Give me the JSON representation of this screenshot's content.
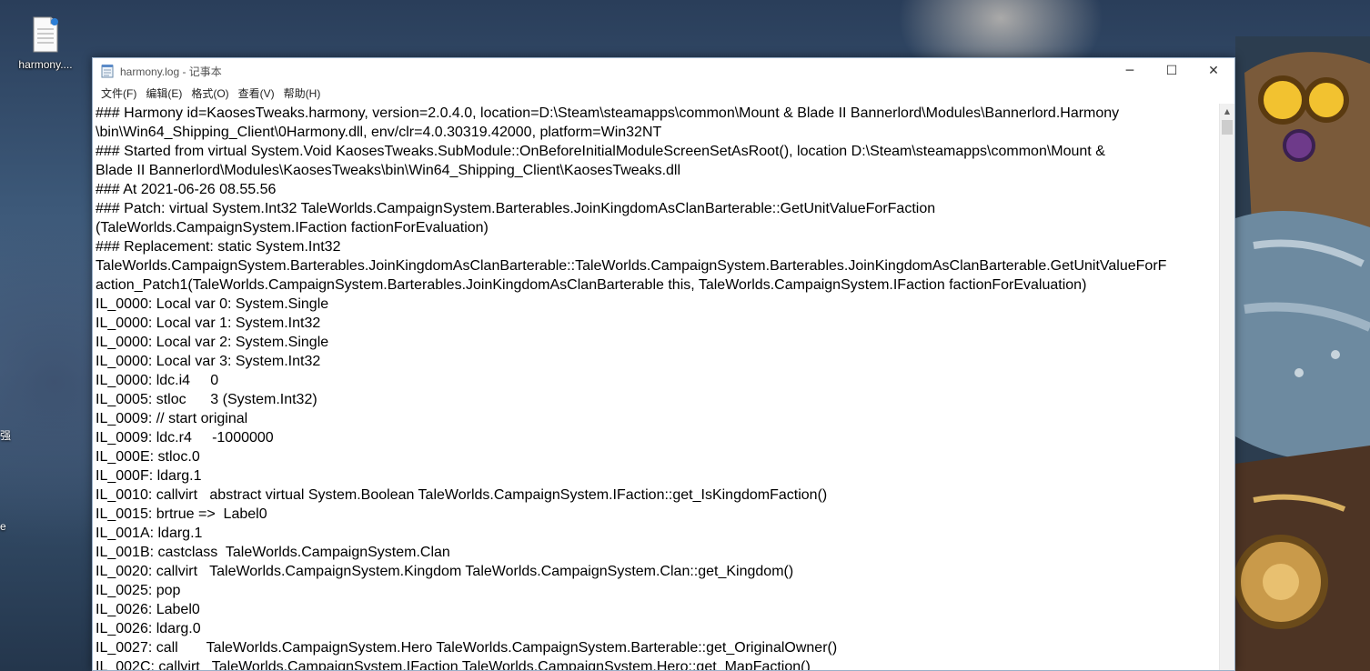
{
  "desktop": {
    "icon_label": "harmony...."
  },
  "edge_glyphs": [
    "强",
    "e"
  ],
  "window": {
    "title": "harmony.log - 记事本",
    "controls": {
      "minimize": "─",
      "maximize": "☐",
      "close": "✕"
    }
  },
  "menu": {
    "items": [
      "文件(F)",
      "编辑(E)",
      "格式(O)",
      "查看(V)",
      "帮助(H)"
    ]
  },
  "content": {
    "lines": [
      "### Harmony id=KaosesTweaks.harmony, version=2.0.4.0, location=D:\\Steam\\steamapps\\common\\Mount & Blade II Bannerlord\\Modules\\Bannerlord.Harmony",
      "\\bin\\Win64_Shipping_Client\\0Harmony.dll, env/clr=4.0.30319.42000, platform=Win32NT",
      "### Started from virtual System.Void KaosesTweaks.SubModule::OnBeforeInitialModuleScreenSetAsRoot(), location D:\\Steam\\steamapps\\common\\Mount &",
      "Blade II Bannerlord\\Modules\\KaosesTweaks\\bin\\Win64_Shipping_Client\\KaosesTweaks.dll",
      "### At 2021-06-26 08.55.56",
      "### Patch: virtual System.Int32 TaleWorlds.CampaignSystem.Barterables.JoinKingdomAsClanBarterable::GetUnitValueForFaction",
      "(TaleWorlds.CampaignSystem.IFaction factionForEvaluation)",
      "### Replacement: static System.Int32",
      "TaleWorlds.CampaignSystem.Barterables.JoinKingdomAsClanBarterable::TaleWorlds.CampaignSystem.Barterables.JoinKingdomAsClanBarterable.GetUnitValueForF",
      "action_Patch1(TaleWorlds.CampaignSystem.Barterables.JoinKingdomAsClanBarterable this, TaleWorlds.CampaignSystem.IFaction factionForEvaluation)",
      "IL_0000: Local var 0: System.Single",
      "IL_0000: Local var 1: System.Int32",
      "IL_0000: Local var 2: System.Single",
      "IL_0000: Local var 3: System.Int32",
      "IL_0000: ldc.i4     0",
      "IL_0005: stloc      3 (System.Int32)",
      "IL_0009: // start original",
      "IL_0009: ldc.r4     -1000000",
      "IL_000E: stloc.0",
      "IL_000F: ldarg.1",
      "IL_0010: callvirt   abstract virtual System.Boolean TaleWorlds.CampaignSystem.IFaction::get_IsKingdomFaction()",
      "IL_0015: brtrue =>  Label0",
      "IL_001A: ldarg.1",
      "IL_001B: castclass  TaleWorlds.CampaignSystem.Clan",
      "IL_0020: callvirt   TaleWorlds.CampaignSystem.Kingdom TaleWorlds.CampaignSystem.Clan::get_Kingdom()",
      "IL_0025: pop",
      "IL_0026: Label0",
      "IL_0026: ldarg.0",
      "IL_0027: call       TaleWorlds.CampaignSystem.Hero TaleWorlds.CampaignSystem.Barterable::get_OriginalOwner()",
      "IL_002C: callvirt   TaleWorlds.CampaignSystem.IFaction TaleWorlds.CampaignSystem.Hero::get_MapFaction()"
    ]
  }
}
